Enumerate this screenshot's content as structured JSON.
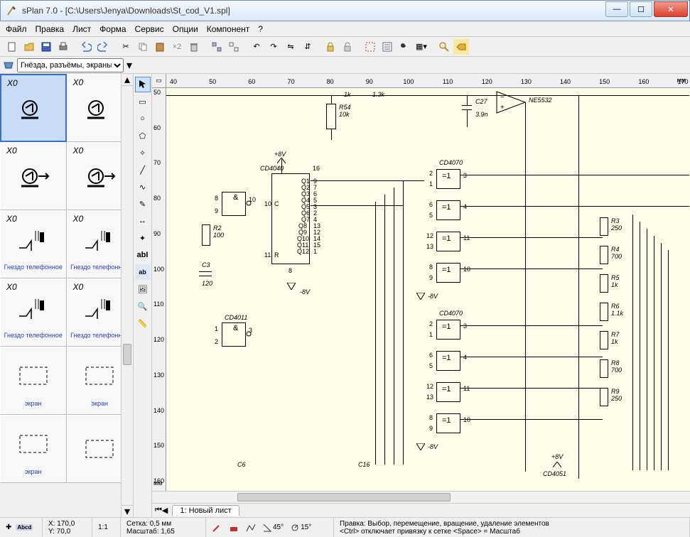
{
  "window": {
    "title": "sPlan 7.0 - [C:\\Users\\Jenya\\Downloads\\St_cod_V1.spl]"
  },
  "menu": [
    "Файл",
    "Правка",
    "Лист",
    "Форма",
    "Сервис",
    "Опции",
    "Компонент",
    "?"
  ],
  "library": {
    "selected": "Гнёзда, разъёмы, экраны"
  },
  "palette": [
    {
      "label": "X0",
      "caption": "",
      "selected": true
    },
    {
      "label": "X0",
      "caption": ""
    },
    {
      "label": "X0",
      "caption": ""
    },
    {
      "label": "X0",
      "caption": ""
    },
    {
      "label": "X0",
      "caption": "Гнездо телефонное"
    },
    {
      "label": "X0",
      "caption": "Гнездо телефонное"
    },
    {
      "label": "X0",
      "caption": "Гнездо телефонное"
    },
    {
      "label": "X0",
      "caption": "Гнездо телефонное"
    },
    {
      "label": "",
      "caption": "экран"
    },
    {
      "label": "",
      "caption": "экран"
    },
    {
      "label": "",
      "caption": "экран"
    },
    {
      "label": "",
      "caption": ""
    }
  ],
  "ruler_h": {
    "start": 40,
    "end": 170,
    "step": 10,
    "unit": "мм"
  },
  "ruler_v": {
    "start": 50,
    "end": 160,
    "step": 10,
    "unit": "мм"
  },
  "tabs": {
    "tab1": "1: Новый лист"
  },
  "status": {
    "x": "X: 170,0",
    "y": "Y: 70,0",
    "ratio": "1:1",
    "grid_label": "Сетка:",
    "grid": "0,5 мм",
    "scale_label": "Масштаб:",
    "scale": "1,65",
    "angle1": "45°",
    "angle2": "15°",
    "hint1": "Правка: Выбор, перемещение, вращение, удаление элементов",
    "hint2": "<Ctrl> отключает привязку к сетке <Space> = Масштаб"
  },
  "schematic": {
    "R54": {
      "ref": "R54",
      "val": "10k"
    },
    "C27": {
      "ref": "C27",
      "val": "3.9n"
    },
    "NE5532": "NE5532",
    "v8p_1": "+8V",
    "v8n_1": "-8V",
    "v8n_2": "-8V",
    "v8n_3": "-8V",
    "v8p_2": "+8V",
    "CD4040": "CD4040",
    "CD4011": "CD4011",
    "CD4070_1": "CD4070",
    "CD4070_2": "CD4070",
    "CD4051": "CD4051",
    "R2": {
      "ref": "R2",
      "val": "100"
    },
    "C3": {
      "ref": "C3",
      "val": "120"
    },
    "R3": {
      "ref": "R3",
      "val": "250"
    },
    "R4": {
      "ref": "R4",
      "val": "700"
    },
    "R5": {
      "ref": "R5",
      "val": "1k"
    },
    "R6": {
      "ref": "R6",
      "val": "1.1k"
    },
    "R7": {
      "ref": "R7",
      "val": "1k"
    },
    "R8": {
      "ref": "R8",
      "val": "700"
    },
    "R9": {
      "ref": "R9",
      "val": "250"
    },
    "C6": "C6",
    "C16": "C16",
    "k1": "1k",
    "k13": "1.3k",
    "pin16": "16",
    "pin8a": "8",
    "pin9a": "9",
    "pin10a": "10",
    "and": "&",
    "eq1": "=1"
  }
}
